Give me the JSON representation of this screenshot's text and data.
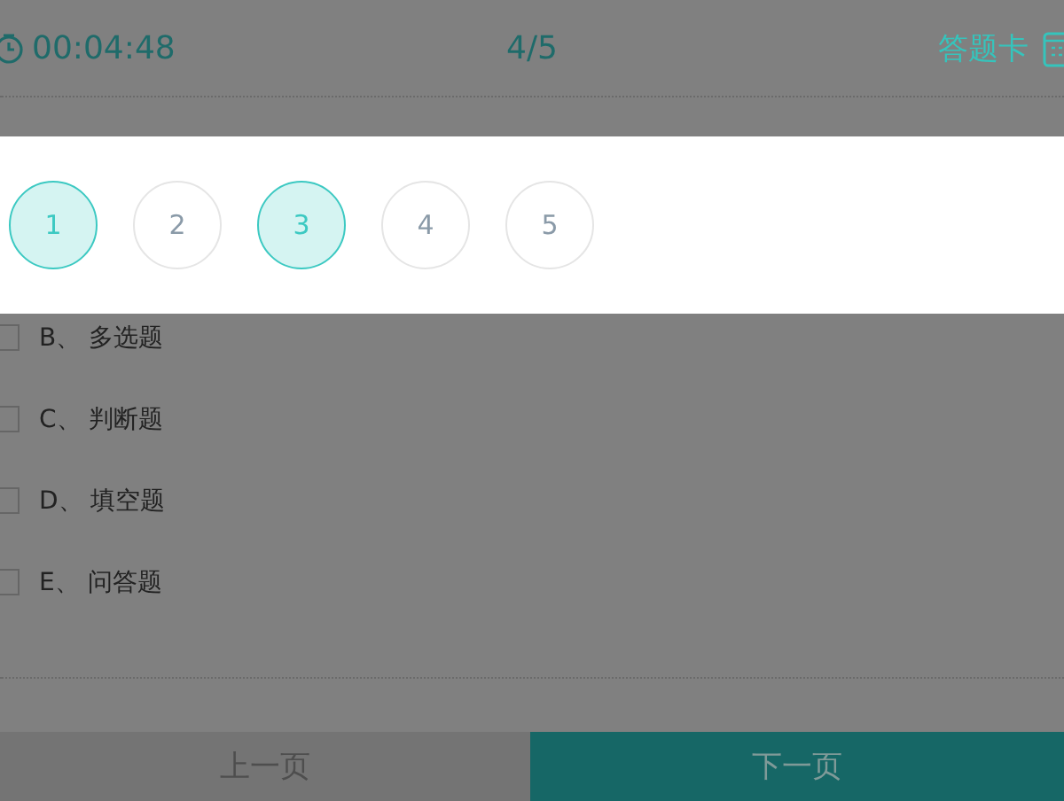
{
  "header": {
    "timer": "00:04:48",
    "progress": "4/5",
    "answer_card": "答题卡"
  },
  "answer_card": {
    "questions": [
      {
        "number": "1",
        "answered": true
      },
      {
        "number": "2",
        "answered": false
      },
      {
        "number": "3",
        "answered": true
      },
      {
        "number": "4",
        "answered": false
      },
      {
        "number": "5",
        "answered": false
      }
    ]
  },
  "options": [
    {
      "label": "B、 多选题",
      "checked": false
    },
    {
      "label": "C、 判断题",
      "checked": false
    },
    {
      "label": "D、 填空题",
      "checked": false
    },
    {
      "label": "E、 问答题",
      "checked": false
    }
  ],
  "footer": {
    "previous": "上一页",
    "next": "下一页"
  }
}
